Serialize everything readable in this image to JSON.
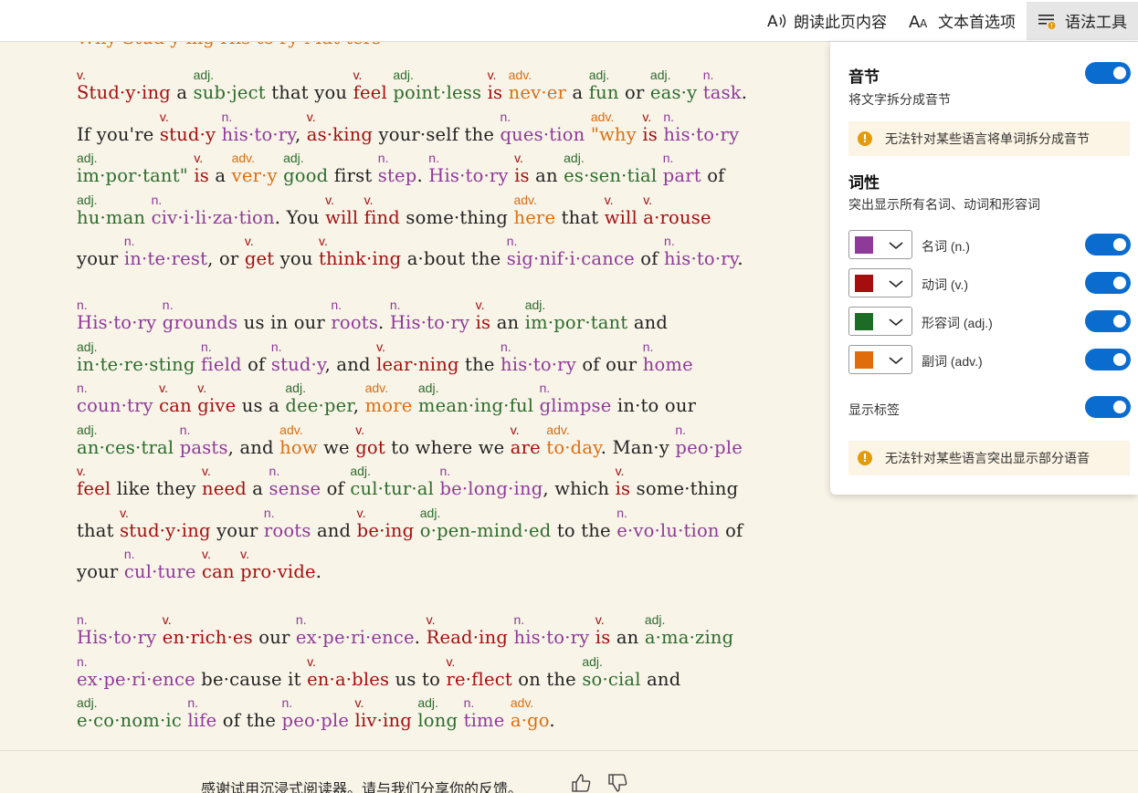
{
  "toolbar": {
    "read_aloud": "朗读此页内容",
    "text_prefs": "文本首选项",
    "grammar_tools": "语法工具"
  },
  "colors": {
    "noun": "#8e3a98",
    "verb": "#a50e0e",
    "adj": "#2d6c2d",
    "adv": "#db6e12",
    "toggle_on": "#0b6cd0"
  },
  "reader": {
    "heading_fragment": "Why Stud·y·ing His·to·ry Mat·ters",
    "paragraphs": [
      [
        [
          [
            "Stud·y·ing",
            "v"
          ],
          "a",
          [
            "sub·ject",
            "adj"
          ],
          "that",
          "you",
          [
            "feel",
            "v"
          ],
          [
            "point·less",
            "adj"
          ],
          [
            "is",
            "v"
          ],
          [
            "nev·er",
            "adv"
          ],
          "a",
          [
            "fun",
            "adj"
          ],
          "or",
          [
            "eas·y",
            "adj"
          ],
          [
            "task",
            "n"
          ],
          "."
        ],
        [
          "If",
          "you're",
          [
            "stud·y",
            "v"
          ],
          [
            "his·to·ry",
            "n"
          ],
          ",",
          [
            "as·king",
            "v"
          ],
          "your·self",
          "the",
          [
            "ques·tion",
            "n"
          ],
          [
            "\"why",
            "adv"
          ],
          [
            "is",
            "v"
          ],
          [
            "his·to·ry",
            "n"
          ]
        ],
        [
          [
            "im·por·tant\"",
            "adj"
          ],
          [
            "is",
            "v"
          ],
          "a",
          [
            "ver·y",
            "adv"
          ],
          [
            "good",
            "adj"
          ],
          "first",
          [
            "step",
            "n"
          ],
          ".",
          [
            "His·to·ry",
            "n"
          ],
          [
            "is",
            "v"
          ],
          "an",
          [
            "es·sen·tial",
            "adj"
          ],
          [
            "part",
            "n"
          ],
          "of"
        ],
        [
          [
            "hu·man",
            "adj"
          ],
          [
            "civ·i·li·za·tion",
            "n"
          ],
          ".",
          "You",
          [
            "will",
            "v"
          ],
          [
            "find",
            "v"
          ],
          "some·thing",
          [
            "here",
            "adv"
          ],
          "that",
          [
            "will",
            "v"
          ],
          [
            "a·rouse",
            "v"
          ]
        ],
        [
          "your",
          [
            "in·te·rest",
            "n"
          ],
          ",",
          "or",
          [
            "get",
            "v"
          ],
          "you",
          [
            "think·ing",
            "v"
          ],
          "a·bout",
          "the",
          [
            "sig·nif·i·cance",
            "n"
          ],
          "of",
          [
            "his·to·ry",
            "n"
          ],
          "."
        ]
      ],
      [
        [
          [
            "His·to·ry",
            "n"
          ],
          [
            "grounds",
            "n"
          ],
          "us",
          "in",
          "our",
          [
            "roots",
            "n"
          ],
          ".",
          [
            "His·to·ry",
            "n"
          ],
          [
            "is",
            "v"
          ],
          "an",
          [
            "im·por·tant",
            "adj"
          ],
          "and"
        ],
        [
          [
            "in·te·re·sting",
            "adj"
          ],
          [
            "field",
            "n"
          ],
          "of",
          [
            "stud·y",
            "n"
          ],
          ",",
          "and",
          [
            "lear·ning",
            "v"
          ],
          "the",
          [
            "his·to·ry",
            "n"
          ],
          "of",
          "our",
          [
            "home",
            "n"
          ]
        ],
        [
          [
            "coun·try",
            "n"
          ],
          [
            "can",
            "v"
          ],
          [
            "give",
            "v"
          ],
          "us",
          "a",
          [
            "dee·per",
            "adj"
          ],
          ",",
          [
            "more",
            "adv"
          ],
          [
            "mean·ing·ful",
            "adj"
          ],
          [
            "glimpse",
            "n"
          ],
          "in·to",
          "our"
        ],
        [
          [
            "an·ces·tral",
            "adj"
          ],
          [
            "pasts",
            "n"
          ],
          ",",
          "and",
          [
            "how",
            "adv"
          ],
          "we",
          [
            "got",
            "v"
          ],
          "to",
          "where",
          "we",
          [
            "are",
            "v"
          ],
          [
            "to·day",
            "adv"
          ],
          ".",
          "Man·y",
          [
            "peo·ple",
            "n"
          ]
        ],
        [
          [
            "feel",
            "v"
          ],
          "like",
          "they",
          [
            "need",
            "v"
          ],
          "a",
          [
            "sense",
            "n"
          ],
          "of",
          [
            "cul·tur·al",
            "adj"
          ],
          [
            "be·long·ing",
            "n"
          ],
          ",",
          "which",
          [
            "is",
            "v"
          ],
          "some·thing"
        ],
        [
          "that",
          [
            "stud·y·ing",
            "v"
          ],
          "your",
          [
            "roots",
            "n"
          ],
          "and",
          [
            "be·ing",
            "v"
          ],
          [
            "o·pen-mind·ed",
            "adj"
          ],
          "to",
          "the",
          [
            "e·vo·lu·tion",
            "n"
          ],
          "of"
        ],
        [
          "your",
          [
            "cul·ture",
            "n"
          ],
          [
            "can",
            "v"
          ],
          [
            "pro·vide",
            "v"
          ],
          "."
        ]
      ],
      [
        [
          [
            "His·to·ry",
            "n"
          ],
          [
            "en·rich·es",
            "v"
          ],
          "our",
          [
            "ex·pe·ri·ence",
            "n"
          ],
          ".",
          [
            "Read·ing",
            "v"
          ],
          [
            "his·to·ry",
            "n"
          ],
          [
            "is",
            "v"
          ],
          "an",
          [
            "a·ma·zing",
            "adj"
          ]
        ],
        [
          [
            "ex·pe·ri·ence",
            "n"
          ],
          "be·cause",
          "it",
          [
            "en·a·bles",
            "v"
          ],
          "us",
          "to",
          [
            "re·flect",
            "v"
          ],
          "on",
          "the",
          [
            "so·cial",
            "adj"
          ],
          "and"
        ],
        [
          [
            "e·co·nom·ic",
            "adj"
          ],
          [
            "life",
            "n"
          ],
          "of",
          "the",
          [
            "peo·ple",
            "n"
          ],
          [
            "liv·ing",
            "v"
          ],
          [
            "long",
            "adj"
          ],
          [
            "time",
            "n"
          ],
          [
            "a·go",
            "adv"
          ],
          "."
        ]
      ]
    ]
  },
  "feedback": {
    "text": "感谢试用沉浸式阅读器。请与我们分享你的反馈。"
  },
  "panel": {
    "syllables_title": "音节",
    "syllables_desc": "将文字拆分成音节",
    "syllables_notice": "无法针对某些语言将单词拆分成音节",
    "pos_title": "词性",
    "pos_desc": "突出显示所有名词、动词和形容词",
    "noun_label": "名词 (n.)",
    "verb_label": "动词 (v.)",
    "adj_label": "形容词 (adj.)",
    "adv_label": "副词 (adv.)",
    "show_labels": "显示标签",
    "pos_notice": "无法针对某些语言突出显示部分语音",
    "toggles": {
      "syllables": true,
      "noun": true,
      "verb": true,
      "adj": true,
      "adv": true,
      "show_labels": true
    }
  }
}
